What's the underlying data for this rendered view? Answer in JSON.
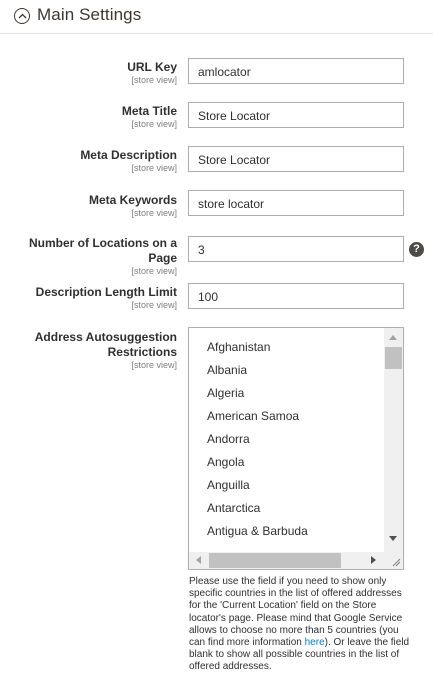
{
  "section": {
    "title": "Main Settings",
    "icon": "collapse-up-icon"
  },
  "fields": [
    {
      "label": "URL Key",
      "scope": "[store view]",
      "value": "amlocator"
    },
    {
      "label": "Meta Title",
      "scope": "[store view]",
      "value": "Store Locator"
    },
    {
      "label": "Meta Description",
      "scope": "[store view]",
      "value": "Store Locator"
    },
    {
      "label": "Meta Keywords",
      "scope": "[store view]",
      "value": "store locator"
    },
    {
      "label": "Number of Locations on a Page",
      "scope": "[store view]",
      "value": "3"
    },
    {
      "label": "Description Length Limit",
      "scope": "[store view]",
      "value": "100"
    }
  ],
  "help_icon": {
    "symbol": "?",
    "icon": "question-help-icon"
  },
  "address": {
    "label": "Address Autosuggestion Restrictions",
    "scope": "[store view]",
    "options": [
      "Afghanistan",
      "Albania",
      "Algeria",
      "American Samoa",
      "Andorra",
      "Angola",
      "Anguilla",
      "Antarctica",
      "Antigua & Barbuda"
    ],
    "note_before": "Please use the field if you need to show only specific countries in the list of offered addresses for the 'Current Location' field on the Store locator's page. Please mind that Google Service allows to choose no more than 5 countries (you can find more information ",
    "note_link": "here",
    "note_after": "). Or leave the field blank to show all possible countries in the list of offered addresses."
  },
  "colors": {
    "link": "#007bdb",
    "title": "#41362f",
    "border": "#adadad"
  }
}
